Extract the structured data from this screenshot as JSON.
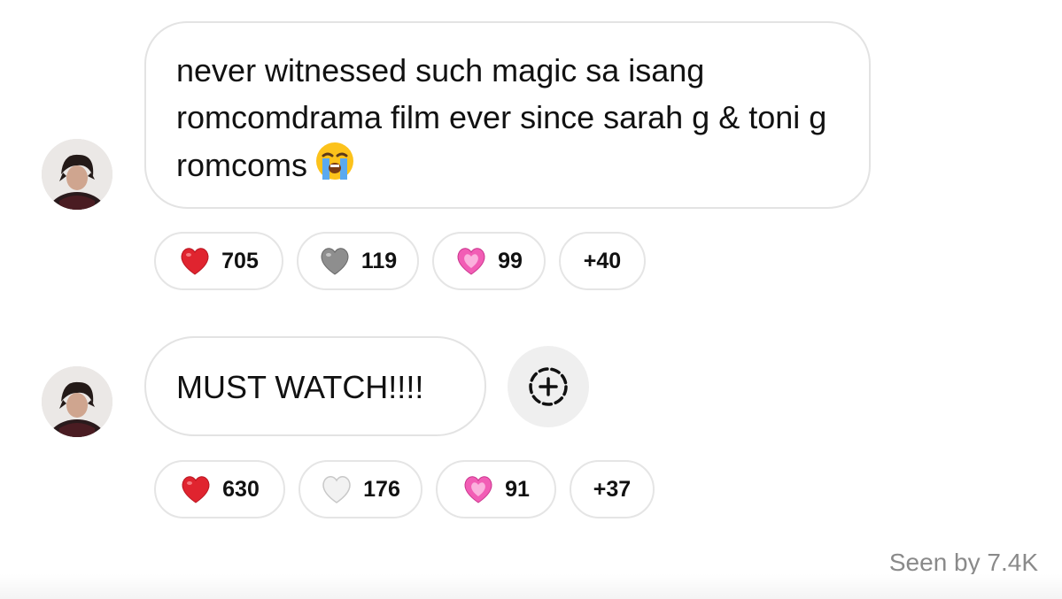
{
  "messages": [
    {
      "text": "never witnessed such magic sa isang romcomdrama film ever since sarah g & toni g romcoms",
      "emoji_icon": "loudly-crying-face-icon",
      "reactions": [
        {
          "icon": "red-heart-icon",
          "color": "#e0242f",
          "count": "705"
        },
        {
          "icon": "grey-heart-icon",
          "color": "#8e8e8e",
          "count": "119"
        },
        {
          "icon": "pink-heart-icon",
          "color": "#f25db5",
          "count": "99"
        }
      ],
      "more_reactions": "+40"
    },
    {
      "text": "MUST WATCH!!!!",
      "reactions": [
        {
          "icon": "red-heart-icon",
          "color": "#e0242f",
          "count": "630"
        },
        {
          "icon": "white-heart-icon",
          "color": "#f2f2f2",
          "count": "176"
        },
        {
          "icon": "pink-heart-icon",
          "color": "#f25db5",
          "count": "91"
        }
      ],
      "more_reactions": "+37"
    }
  ],
  "add_reaction_icon": "add-reaction-icon",
  "seen_by": "Seen by 7.4K"
}
